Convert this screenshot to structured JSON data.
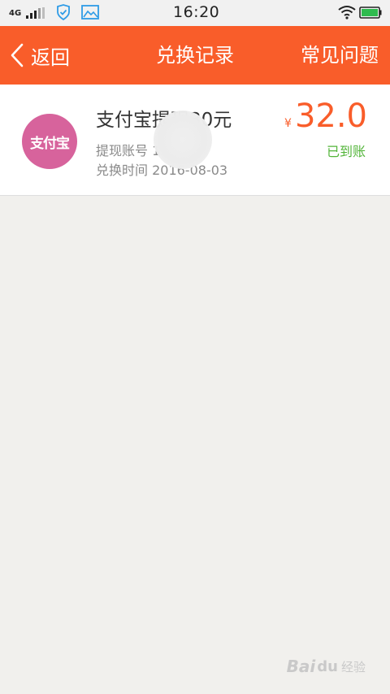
{
  "status_bar": {
    "network": "4G",
    "time": "16:20"
  },
  "header": {
    "back_label": "返回",
    "title": "兑换记录",
    "faq_label": "常见问题"
  },
  "records": [
    {
      "logo_text": "支付宝",
      "title": "支付宝提现30元",
      "account": "提现账号 155592",
      "date": "兑换时间 2016-08-03",
      "currency": "¥",
      "amount": "32.0",
      "status": "已到账"
    }
  ],
  "watermark": {
    "text": "Bai",
    "paw": "du",
    "sub": "经验"
  },
  "colors": {
    "accent": "#f95d2a",
    "success": "#53b53a",
    "logo_bg": "#d7639c"
  }
}
